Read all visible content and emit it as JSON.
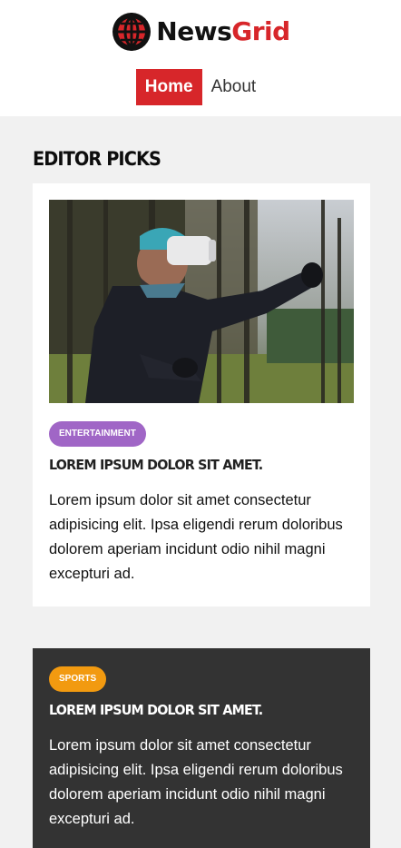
{
  "brand": {
    "name_part1": "News",
    "name_part2": "Grid",
    "accent": "#d7262a"
  },
  "nav": {
    "items": [
      {
        "label": "Home",
        "active": true
      },
      {
        "label": "About",
        "active": false
      }
    ]
  },
  "section": {
    "title": "Editor Picks"
  },
  "articles": [
    {
      "category": "Entertainment",
      "category_color": "#a066c6",
      "title": "Lorem ipsum dolor sit amet.",
      "body": "Lorem ipsum dolor sit amet consectetur adipisicing elit. Ipsa eligendi rerum doloribus dolorem aperiam incidunt odio nihil magni excepturi ad.",
      "image": "vr-headset-person-forest-photo"
    },
    {
      "category": "Sports",
      "category_color": "#f29a10",
      "title": "Lorem ipsum dolor sit amet.",
      "body": "Lorem ipsum dolor sit amet consectetur adipisicing elit. Ipsa eligendi rerum doloribus dolorem aperiam incidunt odio nihil magni excepturi ad."
    }
  ]
}
